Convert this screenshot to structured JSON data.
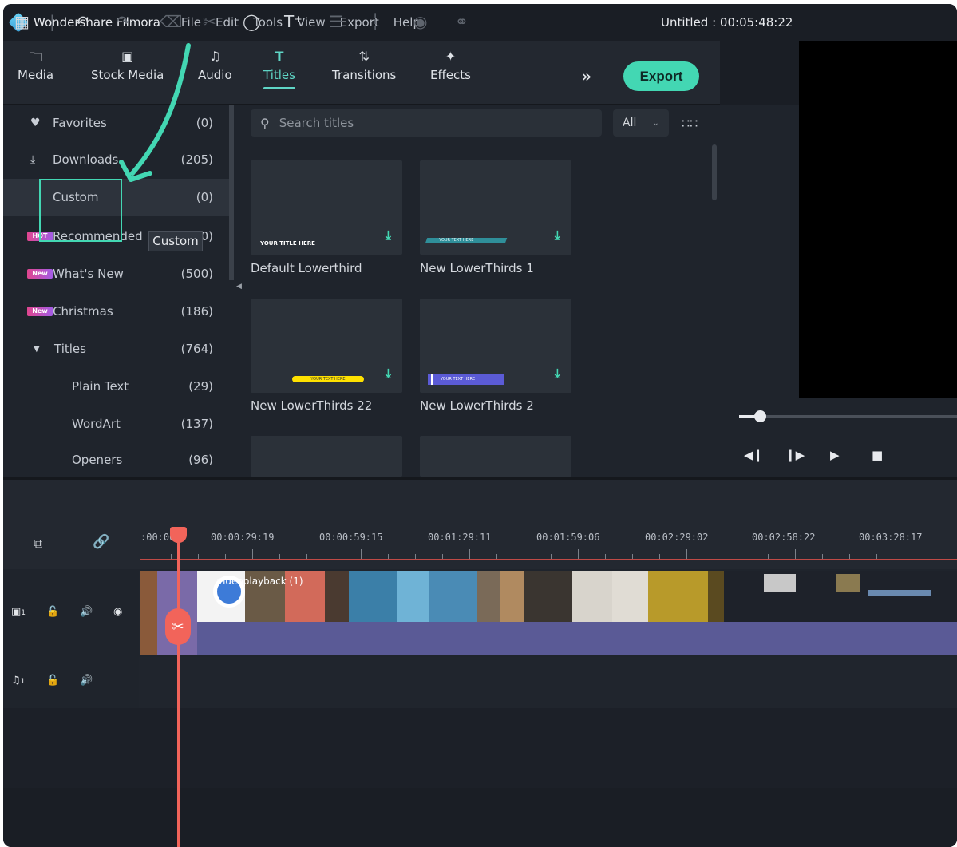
{
  "app": {
    "name": "Wondershare Filmora",
    "doc_title": "Untitled : 00:05:48:22"
  },
  "menu": [
    "File",
    "Edit",
    "Tools",
    "View",
    "Export",
    "Help"
  ],
  "tabs": [
    {
      "label": "Media",
      "icon": "folder-icon"
    },
    {
      "label": "Stock Media",
      "icon": "stock-media-icon"
    },
    {
      "label": "Audio",
      "icon": "music-note-icon"
    },
    {
      "label": "Titles",
      "icon": "title-t-icon",
      "active": true
    },
    {
      "label": "Transitions",
      "icon": "transitions-icon"
    },
    {
      "label": "Effects",
      "icon": "effects-icon"
    }
  ],
  "more_label": "»",
  "export_label": "Export",
  "sidebar": [
    {
      "label": "Favorites",
      "count": "(0)",
      "icon": "heart-icon"
    },
    {
      "label": "Downloads",
      "count": "(205)",
      "icon": "download-icon"
    },
    {
      "label": "Custom",
      "count": "(0)",
      "active": true
    },
    {
      "label": "Recommended",
      "count": "(0)",
      "badge": "HOT"
    },
    {
      "label": "What's New",
      "count": "(500)",
      "badge": "New"
    },
    {
      "label": "Christmas",
      "count": "(186)",
      "badge": "New"
    },
    {
      "label": "Titles",
      "count": "(764)",
      "icon": "caret-down-icon"
    },
    {
      "label": "Plain Text",
      "count": "(29)"
    },
    {
      "label": "WordArt",
      "count": "(137)"
    },
    {
      "label": "Openers",
      "count": "(96)"
    }
  ],
  "tooltip": "Custom",
  "search": {
    "placeholder": "Search titles"
  },
  "filter": {
    "value": "All"
  },
  "cards": [
    {
      "title": "Default Lowerthird",
      "overlay": "YOUR TITLE HERE",
      "style": "plain"
    },
    {
      "title": "New LowerThirds 1",
      "overlay": "YOUR TEXT HERE",
      "style": "teal"
    },
    {
      "title": "New LowerThirds 22",
      "overlay": "YOUR TEXT HERE",
      "style": "yellow"
    },
    {
      "title": "New LowerThirds 2",
      "overlay": "YOUR TEXT HERE",
      "style": "purple"
    }
  ],
  "timeline": {
    "timecodes": [
      ":00:00",
      "00:00:29:19",
      "00:00:59:15",
      "00:01:29:11",
      "00:01:59:06",
      "00:02:29:02",
      "00:02:58:22",
      "00:03:28:17"
    ],
    "clip_name": "videoplayback (1)",
    "video_track": "1",
    "audio_track": "1"
  },
  "colors": {
    "accent": "#43d7b3",
    "playhead": "#f2645a",
    "clip": "#5a5a96",
    "background": "#1f242c"
  }
}
